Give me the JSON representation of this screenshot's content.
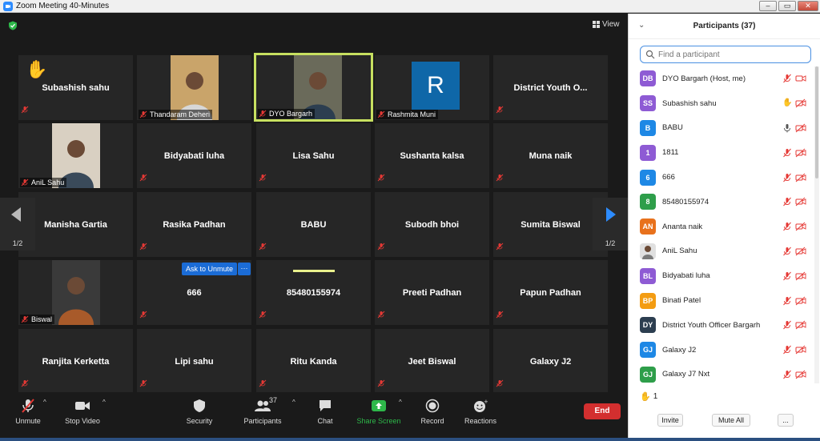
{
  "window": {
    "title": "Zoom Meeting 40-Minutes"
  },
  "view_label": "View",
  "tiles": [
    {
      "id": "t1",
      "name": "Subashish sahu",
      "label": "",
      "raise": true
    },
    {
      "id": "t2",
      "name": "",
      "label": "Thandaram Deheri",
      "video": true
    },
    {
      "id": "t3",
      "name": "",
      "label": "DYO Bargarh",
      "video": true,
      "active": true
    },
    {
      "id": "t4",
      "name": "",
      "label": "Rashmita Muni",
      "avatar": "R"
    },
    {
      "id": "t5",
      "name": "District Youth O..."
    },
    {
      "id": "t6",
      "name": "",
      "label": "AniL Sahu",
      "video": true
    },
    {
      "id": "t7",
      "name": "Bidyabati luha"
    },
    {
      "id": "t8",
      "name": "Lisa Sahu"
    },
    {
      "id": "t9",
      "name": "Sushanta kalsa"
    },
    {
      "id": "t10",
      "name": "Muna naik"
    },
    {
      "id": "t11",
      "name": "Manisha Gartia"
    },
    {
      "id": "t12",
      "name": "Rasika Padhan"
    },
    {
      "id": "t13",
      "name": "BABU"
    },
    {
      "id": "t14",
      "name": "Subodh bhoi"
    },
    {
      "id": "t15",
      "name": "Sumita Biswal"
    },
    {
      "id": "t16",
      "name": "",
      "label": "Biswal",
      "video": true
    },
    {
      "id": "t17",
      "name": "666"
    },
    {
      "id": "t18",
      "name": "85480155974"
    },
    {
      "id": "t19",
      "name": "Preeti Padhan"
    },
    {
      "id": "t20",
      "name": "Papun Padhan"
    },
    {
      "id": "t21",
      "name": "Ranjita Kerketta"
    },
    {
      "id": "t22",
      "name": "Lipi sahu"
    },
    {
      "id": "t23",
      "name": "Ritu Kanda"
    },
    {
      "id": "t24",
      "name": "Jeet Biswal"
    },
    {
      "id": "t25",
      "name": "Galaxy J2"
    }
  ],
  "ask_to_unmute": "Ask to Unmute",
  "ask_more": "···",
  "pager": {
    "left": "1/2",
    "right": "1/2"
  },
  "toolbar": {
    "unmute": "Unmute",
    "stop_video": "Stop Video",
    "security": "Security",
    "participants": "Participants",
    "participants_count": "37",
    "chat": "Chat",
    "share_screen": "Share Screen",
    "record": "Record",
    "reactions": "Reactions",
    "end": "End"
  },
  "panel": {
    "title": "Participants (37)",
    "search_placeholder": "Find a participant",
    "participants": [
      {
        "initials": "DB",
        "name": "DYO Bargarh (Host, me)",
        "color": "#8e5bd4"
      },
      {
        "initials": "SS",
        "name": "Subashish sahu",
        "color": "#8e5bd4"
      },
      {
        "initials": "B",
        "name": "BABU",
        "color": "#1e88e5"
      },
      {
        "initials": "1",
        "name": "1811",
        "color": "#8e5bd4"
      },
      {
        "initials": "6",
        "name": "666",
        "color": "#1e88e5"
      },
      {
        "initials": "8",
        "name": "85480155974",
        "color": "#2e9e4a"
      },
      {
        "initials": "AN",
        "name": "Ananta naik",
        "color": "#e8711c"
      },
      {
        "initials": "",
        "name": "AniL Sahu",
        "color": "#9e9e9e"
      },
      {
        "initials": "BL",
        "name": "Bidyabati luha",
        "color": "#8e5bd4"
      },
      {
        "initials": "BP",
        "name": "Binati Patel",
        "color": "#f39c12"
      },
      {
        "initials": "DY",
        "name": "District Youth Officer Bargarh",
        "color": "#2c3e50"
      },
      {
        "initials": "GJ",
        "name": "Galaxy J2",
        "color": "#1e88e5"
      },
      {
        "initials": "GJ",
        "name": "Galaxy J7 Nxt",
        "color": "#2e9e4a"
      }
    ],
    "raised_count": "1",
    "invite": "Invite",
    "mute_all": "Mute All",
    "more": "..."
  }
}
